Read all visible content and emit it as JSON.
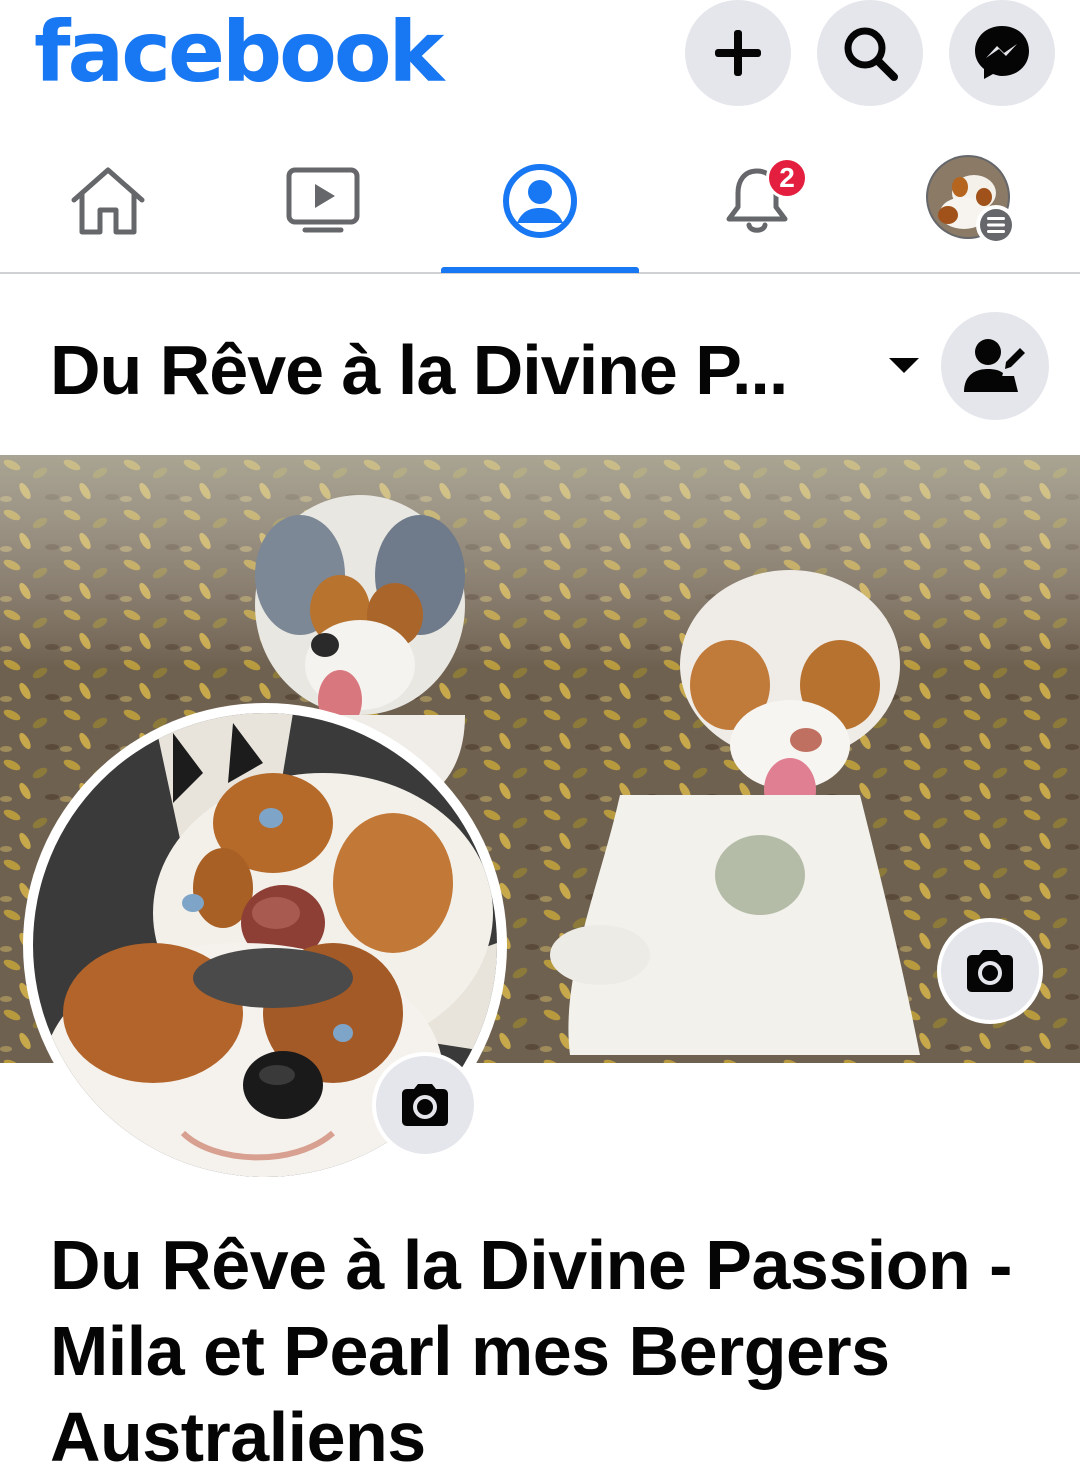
{
  "app": {
    "logo_text": "facebook",
    "brand_color": "#1877f2"
  },
  "header": {
    "buttons": [
      {
        "icon": "plus-icon"
      },
      {
        "icon": "search-icon"
      },
      {
        "icon": "messenger-icon"
      }
    ]
  },
  "nav": {
    "items": [
      {
        "icon": "home-icon",
        "active": false
      },
      {
        "icon": "watch-icon",
        "active": false
      },
      {
        "icon": "profile-icon",
        "active": true
      },
      {
        "icon": "bell-icon",
        "active": false,
        "badge": "2"
      },
      {
        "icon": "menu-avatar-icon",
        "active": false
      }
    ],
    "notification_badge": "2",
    "badge_color": "#e41e3f"
  },
  "page": {
    "title_truncated": "Du Rêve à la Divine P...",
    "full_name": "Du Rêve à la Divine Passion - Mila et Pearl mes Bergers Australiens"
  },
  "cover": {
    "camera_icon": "camera-icon"
  },
  "profile_picture": {
    "camera_icon": "camera-icon"
  }
}
